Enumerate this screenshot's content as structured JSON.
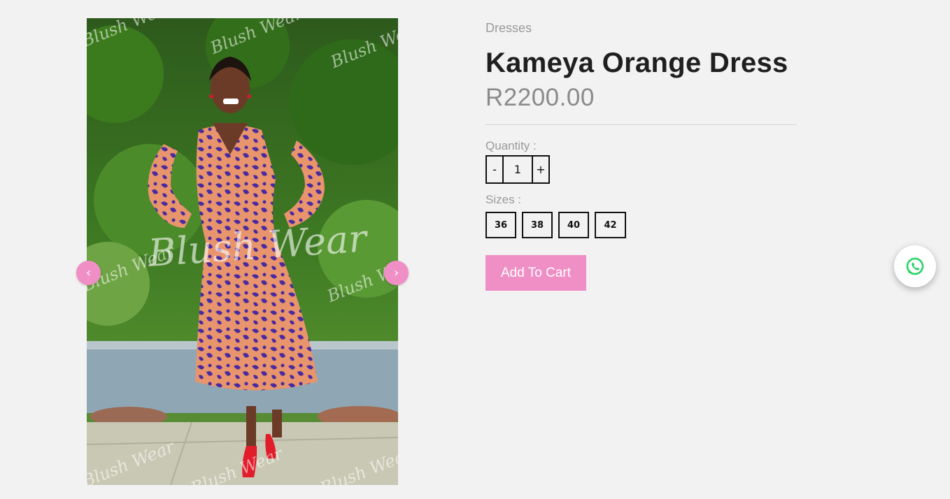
{
  "product": {
    "category": "Dresses",
    "title": "Kameya Orange Dress",
    "price": "R2200.00",
    "image_watermark": "Blush Wear"
  },
  "quantity": {
    "label": "Quantity :",
    "decrement_label": "-",
    "value": "1",
    "increment_label": "+"
  },
  "sizes": {
    "label": "Sizes :",
    "options": [
      "36",
      "38",
      "40",
      "42"
    ]
  },
  "cart": {
    "add_label": "Add To Cart"
  },
  "gallery": {
    "prev_label": "‹",
    "next_label": "›"
  },
  "icons": {
    "whatsapp": "whatsapp-icon"
  },
  "colors": {
    "accent_pink": "#f08fc5",
    "whatsapp_green": "#25d366",
    "background": "#f2f2f2"
  }
}
